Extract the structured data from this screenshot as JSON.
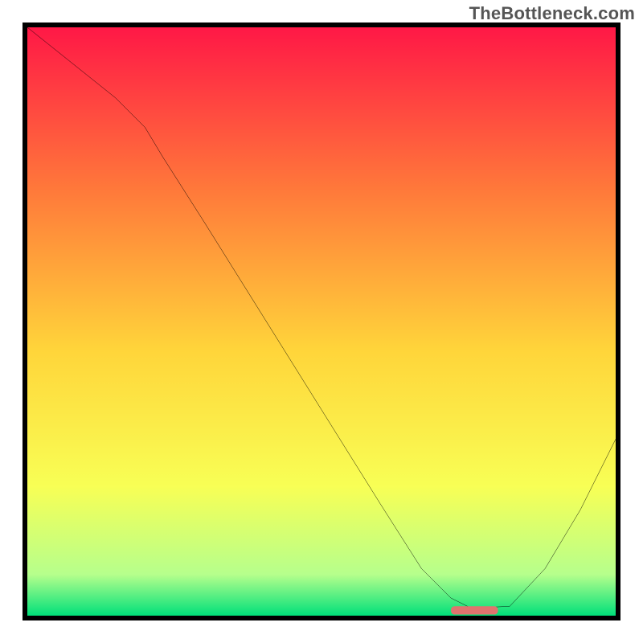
{
  "watermark": "TheBottleneck.com",
  "chart_data": {
    "type": "line",
    "title": "",
    "xlabel": "",
    "ylabel": "",
    "xlim": [
      0,
      100
    ],
    "ylim": [
      0,
      100
    ],
    "grid": false,
    "background_gradient": {
      "top": "#ff1846",
      "mid_upper": "#ff7a3a",
      "mid": "#ffd53a",
      "mid_lower": "#f8ff55",
      "near_bottom": "#b6ff8c",
      "bottom": "#00e07a"
    },
    "series": [
      {
        "name": "bottleneck-curve",
        "color": "#000000",
        "x": [
          0,
          5,
          10,
          15,
          20,
          23,
          30,
          40,
          50,
          60,
          67,
          72,
          75,
          78,
          82,
          88,
          94,
          100
        ],
        "y": [
          100,
          96,
          92,
          88,
          83,
          78,
          67,
          51,
          35,
          19,
          8,
          3,
          1.5,
          1.4,
          1.6,
          8,
          18,
          30
        ]
      }
    ],
    "marker": {
      "name": "optimal-region",
      "color": "#e0746e",
      "x_range": [
        72,
        80
      ],
      "y": 0.9
    }
  }
}
